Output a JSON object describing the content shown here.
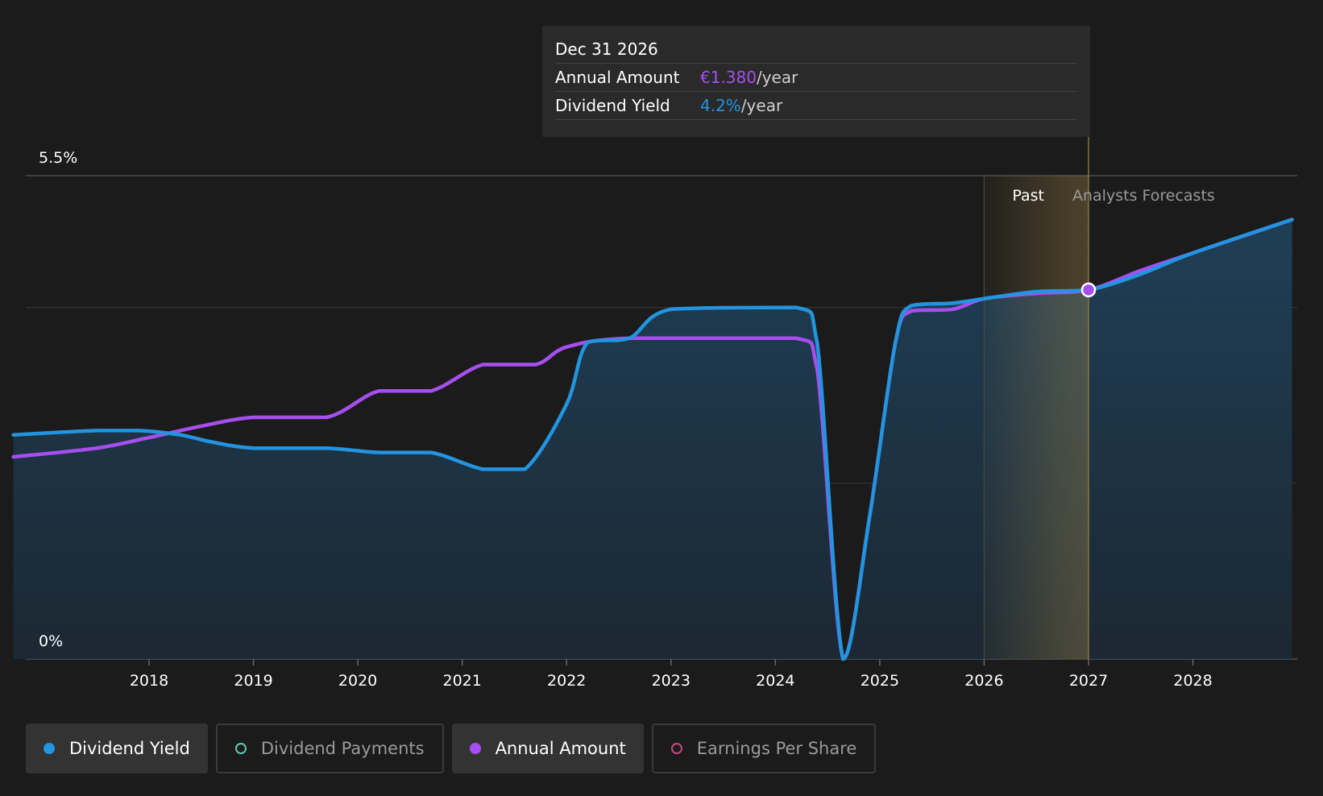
{
  "chart_data": {
    "type": "line",
    "ylim": [
      0,
      5.5
    ],
    "y_tick_labels": [
      "5.5%",
      "0%"
    ],
    "y_gridlines": [
      2.0,
      4.0
    ],
    "x_tick_labels": [
      "2018",
      "2019",
      "2020",
      "2021",
      "2022",
      "2023",
      "2024",
      "2025",
      "2026",
      "2027",
      "2028"
    ],
    "xlim": [
      2016.2,
      2028.95
    ],
    "past_label": "Past",
    "forecast_label": "Analysts Forecasts",
    "past_region": [
      2026.0,
      2027.0
    ],
    "series": [
      {
        "name": "Dividend Yield",
        "color": "#2394df",
        "points": [
          [
            2016.7,
            2.55
          ],
          [
            2017.5,
            2.6
          ],
          [
            2017.9,
            2.6
          ],
          [
            2018.3,
            2.55
          ],
          [
            2018.6,
            2.47
          ],
          [
            2019.0,
            2.4
          ],
          [
            2019.7,
            2.4
          ],
          [
            2020.2,
            2.35
          ],
          [
            2020.7,
            2.35
          ],
          [
            2021.2,
            2.16
          ],
          [
            2021.6,
            2.16
          ],
          [
            2022.0,
            2.9
          ],
          [
            2022.2,
            3.6
          ],
          [
            2022.6,
            3.65
          ],
          [
            2023.0,
            3.98
          ],
          [
            2024.2,
            4.0
          ],
          [
            2024.4,
            3.6
          ],
          [
            2024.65,
            0.0
          ],
          [
            2024.9,
            1.6
          ],
          [
            2025.15,
            3.6
          ],
          [
            2025.3,
            4.02
          ],
          [
            2025.7,
            4.05
          ],
          [
            2026.0,
            4.1
          ],
          [
            2026.5,
            4.18
          ],
          [
            2027.0,
            4.2
          ],
          [
            2027.5,
            4.38
          ],
          [
            2028.0,
            4.62
          ],
          [
            2028.95,
            5.0
          ]
        ]
      },
      {
        "name": "Annual Amount",
        "color": "#a64ff0",
        "points": [
          [
            2016.7,
            2.3
          ],
          [
            2017.5,
            2.4
          ],
          [
            2018.0,
            2.52
          ],
          [
            2018.5,
            2.65
          ],
          [
            2019.0,
            2.75
          ],
          [
            2019.7,
            2.75
          ],
          [
            2020.2,
            3.05
          ],
          [
            2020.7,
            3.05
          ],
          [
            2021.2,
            3.35
          ],
          [
            2021.7,
            3.35
          ],
          [
            2022.0,
            3.55
          ],
          [
            2022.6,
            3.65
          ],
          [
            2024.2,
            3.65
          ],
          [
            2024.4,
            3.3
          ],
          [
            2024.65,
            0.0
          ],
          [
            2024.9,
            1.6
          ],
          [
            2025.15,
            3.6
          ],
          [
            2025.3,
            3.96
          ],
          [
            2025.7,
            3.98
          ],
          [
            2026.0,
            4.1
          ],
          [
            2026.5,
            4.16
          ],
          [
            2027.0,
            4.2
          ],
          [
            2027.5,
            4.42
          ],
          [
            2028.0,
            4.62
          ],
          [
            2028.95,
            5.0
          ]
        ]
      }
    ],
    "highlight": {
      "x": 2027.0,
      "y": 4.2
    }
  },
  "tooltip": {
    "date": "Dec 31 2026",
    "rows": [
      {
        "label": "Annual Amount",
        "value": "€1.380",
        "suffix": "/year",
        "color": "#a64ff0"
      },
      {
        "label": "Dividend Yield",
        "value": "4.2%",
        "suffix": "/year",
        "color": "#2394df"
      }
    ]
  },
  "legend": [
    {
      "label": "Dividend Yield",
      "active": true,
      "dot_color": "#2394df",
      "filled": true
    },
    {
      "label": "Dividend Payments",
      "active": false,
      "dot_color": "#5ec9b5",
      "filled": false
    },
    {
      "label": "Annual Amount",
      "active": true,
      "dot_color": "#a64ff0",
      "filled": true
    },
    {
      "label": "Earnings Per Share",
      "active": false,
      "dot_color": "#c4487e",
      "filled": false
    }
  ]
}
